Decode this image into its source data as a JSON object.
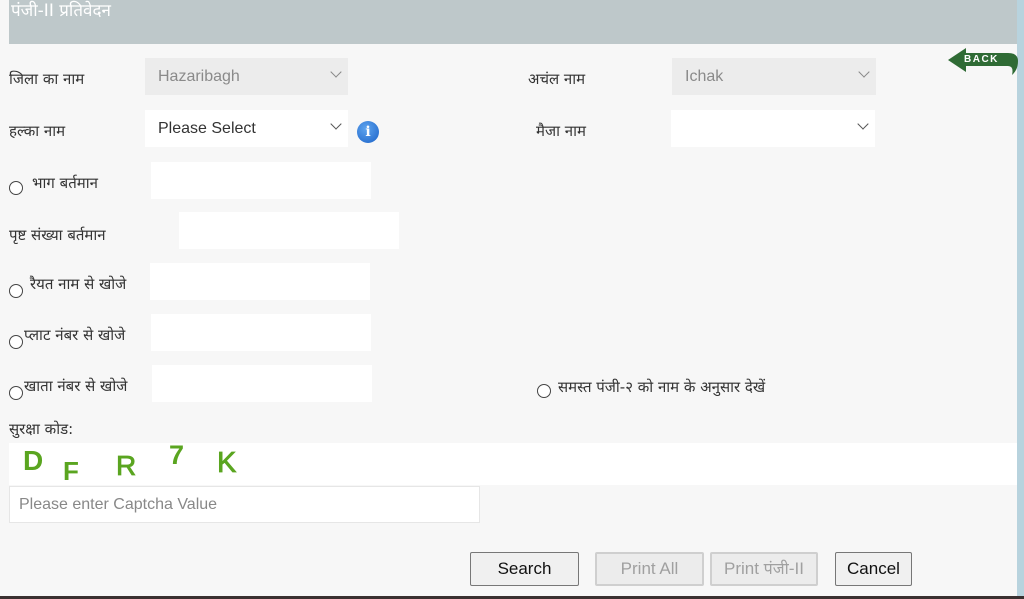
{
  "header": {
    "title": "पंजी-II प्रतिवेदन"
  },
  "back_button": {
    "label": "BACK",
    "color": "#2f6b35"
  },
  "form": {
    "district": {
      "label": "जिला का नाम",
      "value": "Hazaribagh",
      "disabled": true
    },
    "circle": {
      "label": "अचंल नाम",
      "value": "Ichak",
      "disabled": true
    },
    "halka": {
      "label": "हल्का नाम",
      "value": "Please Select"
    },
    "mauza": {
      "label": "मैजा नाम",
      "value": ""
    },
    "bhag": {
      "label": "भाग बर्तमान",
      "value": ""
    },
    "page_no": {
      "label": "पृष्ट संख्या बर्तमान",
      "value": ""
    },
    "raiyat": {
      "label": "रैयत नाम से खोजे",
      "value": ""
    },
    "plot": {
      "label": "प्लाट नंबर से खोजे",
      "value": ""
    },
    "khata": {
      "label": "खाता नंबर से खोजे",
      "value": ""
    },
    "all_register": {
      "label": "समस्त पंजी-२ को नाम के अनुसार देखें"
    }
  },
  "captcha": {
    "label": "सुरक्षा कोड:",
    "chars": [
      "D",
      "F",
      "R",
      "7",
      "K"
    ],
    "color": "#5aa520",
    "input_placeholder": "Please enter Captcha Value"
  },
  "buttons": {
    "search": "Search",
    "print_all": "Print All",
    "print_prefix": "Print ",
    "print_suffix": "पंजी-II",
    "cancel": "Cancel"
  }
}
